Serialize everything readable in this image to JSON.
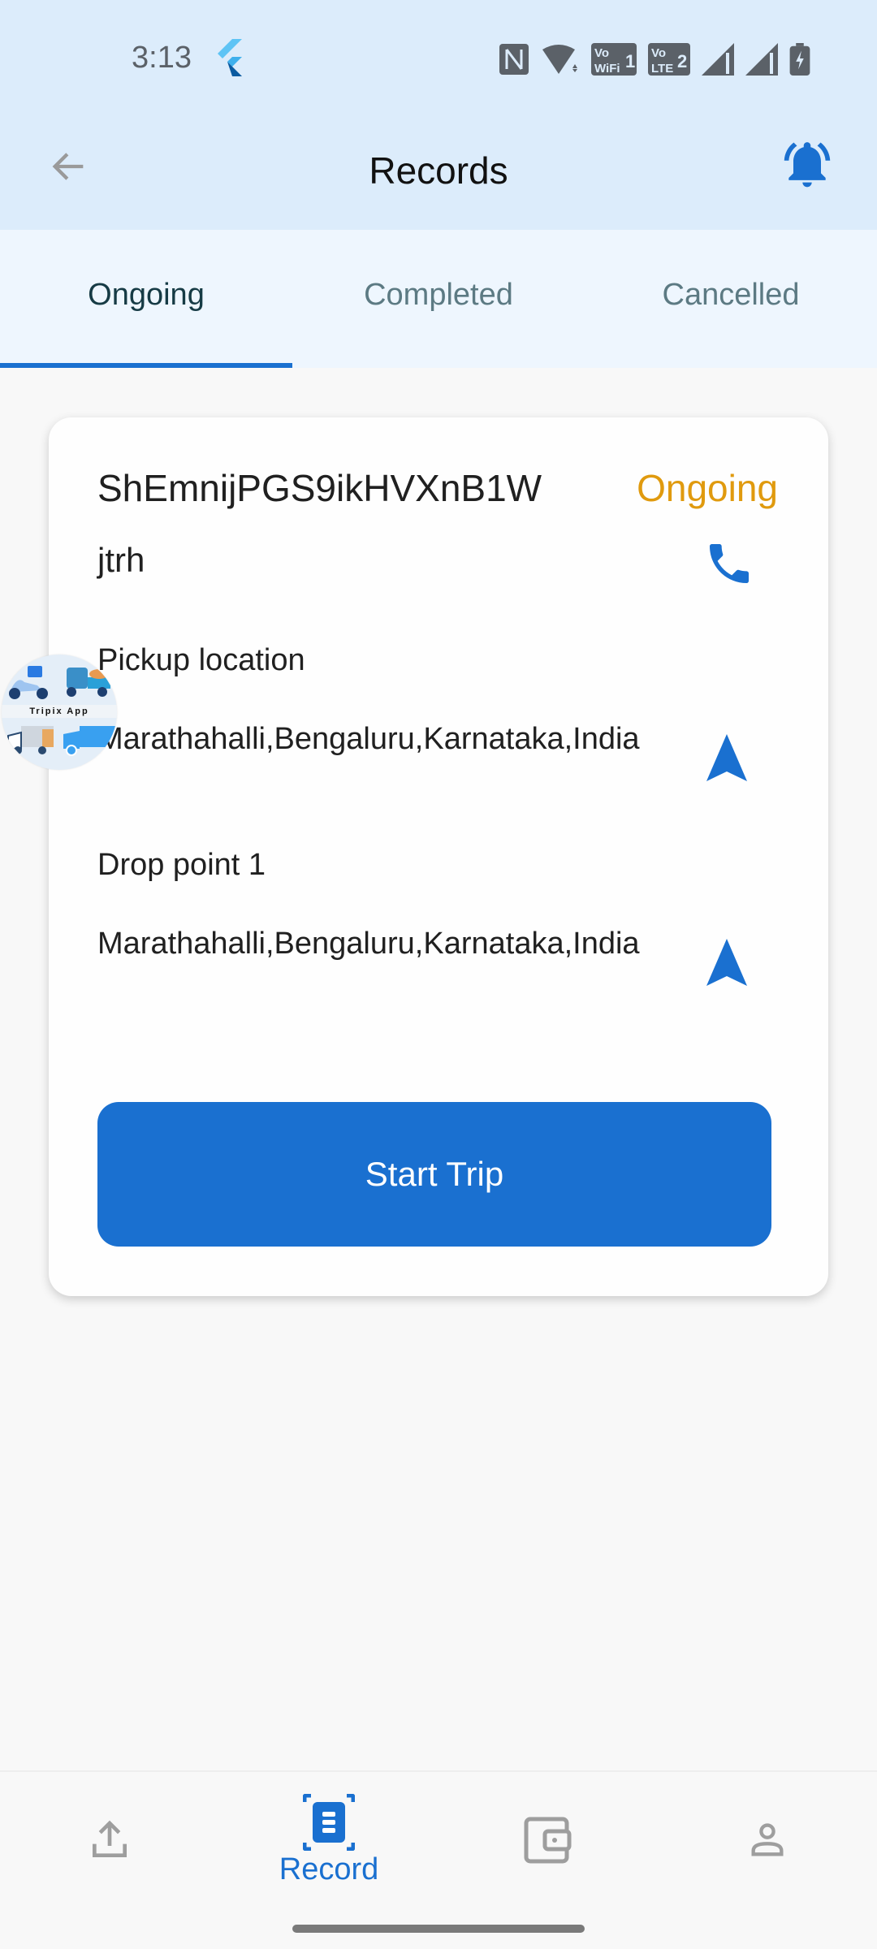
{
  "status_bar": {
    "time": "3:13",
    "icons": [
      "flutter-icon",
      "nfc-icon",
      "wifi-icon",
      "vowifi-1-icon",
      "volte-2-icon",
      "signal-1-icon",
      "signal-2-icon",
      "battery-charging-icon"
    ],
    "vowifi_label": "Vo WiFi 1",
    "volte_label": "Vo LTE 2"
  },
  "app_bar": {
    "title": "Records",
    "back_icon": "arrow-left-icon",
    "notification_icon": "bell-ringing-icon"
  },
  "tabs": [
    {
      "label": "Ongoing",
      "active": true
    },
    {
      "label": "Completed",
      "active": false
    },
    {
      "label": "Cancelled",
      "active": false
    }
  ],
  "trip_card": {
    "trip_id": "ShEmnijPGS9ikHVXnB1W",
    "status": "Ongoing",
    "customer_name": "jtrh",
    "pickup_label": "Pickup location",
    "pickup_address": "Marathahalli,Bengaluru,Karnataka,India",
    "drop_label": "Drop point 1",
    "drop_address": "Marathahalli,Bengaluru,Karnataka,India",
    "start_button": "Start Trip"
  },
  "floating_logo": {
    "text": "Tripix App"
  },
  "bottom_nav": [
    {
      "label": "",
      "icon": "upload-icon",
      "active": false
    },
    {
      "label": "Record",
      "icon": "record-document-icon",
      "active": true
    },
    {
      "label": "",
      "icon": "wallet-icon",
      "active": false
    },
    {
      "label": "",
      "icon": "person-icon",
      "active": false
    }
  ],
  "colors": {
    "accent": "#1a70d0",
    "status_ongoing": "#e09a0e",
    "header_bg": "#dcecfb",
    "tabs_bg": "#eef6fe",
    "inactive_icon": "#9e9e9e"
  }
}
